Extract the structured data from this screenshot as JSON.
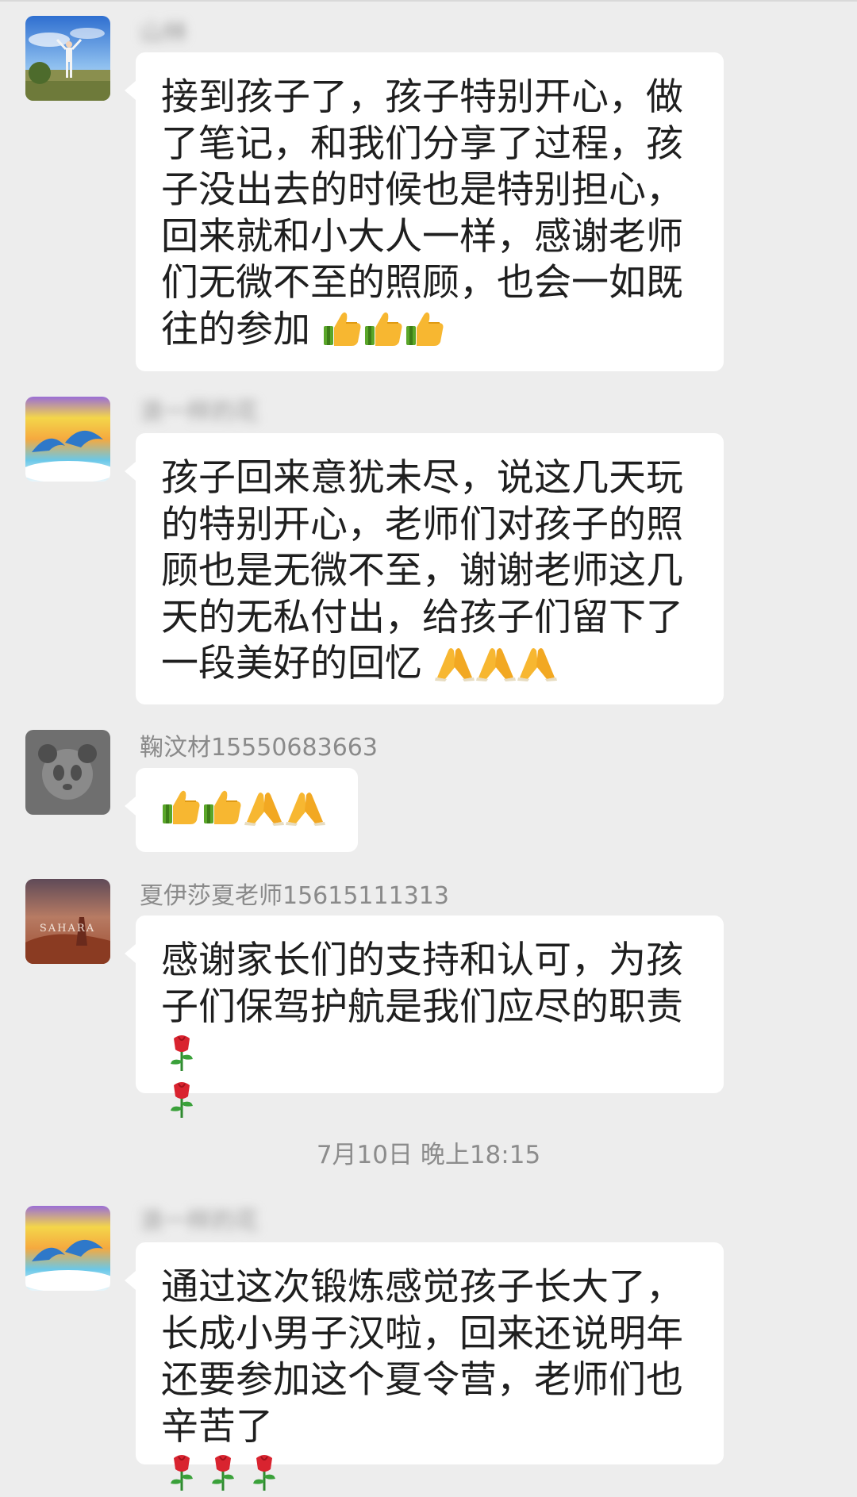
{
  "messages": [
    {
      "sender": "山林",
      "sender_blurred": true,
      "avatar_icon": "person-outdoor-avatar",
      "text": "接到孩子了，孩子特别开心，做了笔记，和我们分享了过程，孩子没出去的时候也是特别担心，回来就和小大人一样，感谢老师们无微不至的照顾，也会一如既往的参加",
      "emoji_icons": [
        "thumbs-up-icon",
        "thumbs-up-icon",
        "thumbs-up-icon"
      ]
    },
    {
      "sender": "浪一样的花",
      "sender_blurred": true,
      "avatar_icon": "dolphins-rainbow-avatar",
      "text": "孩子回来意犹未尽，说这几天玩的特别开心，老师们对孩子的照顾也是无微不至，谢谢老师这几天的无私付出，给孩子们留下了一段美好的回忆",
      "emoji_icons": [
        "pray-hands-icon",
        "pray-hands-icon",
        "pray-hands-icon"
      ]
    },
    {
      "sender": "鞠汶材15550683663",
      "sender_blurred": false,
      "avatar_icon": "panda-avatar",
      "text": "",
      "emoji_icons": [
        "thumbs-up-icon",
        "thumbs-up-icon",
        "pray-hands-icon",
        "pray-hands-icon"
      ]
    },
    {
      "sender": "夏伊莎夏老师15615111313",
      "sender_blurred": false,
      "avatar_icon": "sahara-desert-avatar",
      "avatar_text": "SAHARA",
      "text": "感谢家长们的支持和认可，为孩子们保驾护航是我们应尽的职责",
      "emoji_icons": [
        "rose-icon",
        "rose-icon"
      ]
    },
    {
      "sender": "浪一样的花",
      "sender_blurred": true,
      "avatar_icon": "dolphins-rainbow-avatar",
      "text": "通过这次锻炼感觉孩子长大了，长成小男子汉啦，回来还说明年还要参加这个夏令营，老师们也辛苦了",
      "emoji_icons": [
        "rose-icon",
        "rose-icon",
        "rose-icon"
      ]
    }
  ],
  "timestamp": "7月10日 晚上18:15",
  "colors": {
    "background": "#ededed",
    "bubble": "#ffffff",
    "text": "#1f1f1f",
    "meta_text": "#8a8a8a"
  }
}
